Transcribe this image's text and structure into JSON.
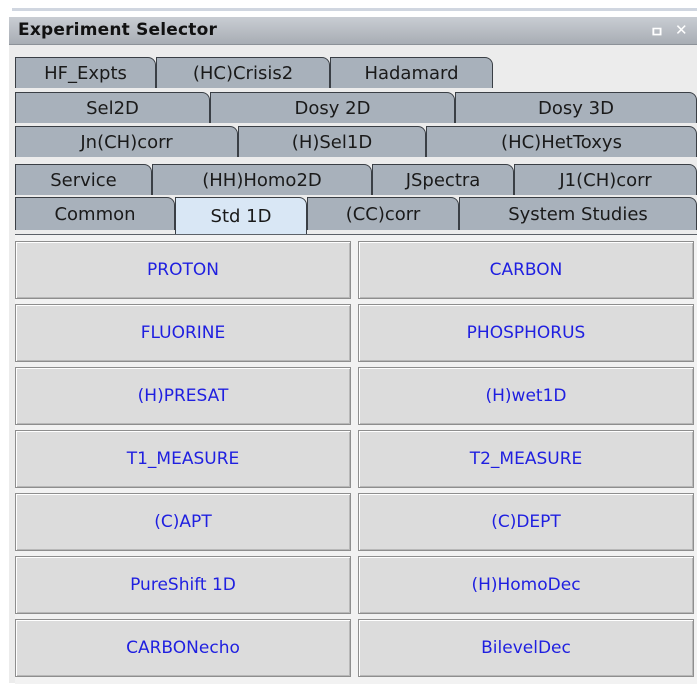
{
  "window": {
    "title": "Experiment Selector",
    "pin_icon": "pin-icon",
    "close_icon": "close-icon"
  },
  "tab_rows": [
    [
      "HF_Expts",
      "(HC)Crisis2",
      "Hadamard"
    ],
    [
      "Sel2D",
      "Dosy 2D",
      "Dosy 3D"
    ],
    [
      "Jn(CH)corr",
      "(H)Sel1D",
      "(HC)HetToxys"
    ],
    [
      "Service",
      "(HH)Homo2D",
      "JSpectra",
      "J1(CH)corr"
    ],
    [
      "Common",
      "Std 1D",
      "(CC)corr",
      "System Studies"
    ]
  ],
  "active_tab": "Std 1D",
  "buttons": [
    [
      "PROTON",
      "CARBON"
    ],
    [
      "FLUORINE",
      "PHOSPHORUS"
    ],
    [
      "(H)PRESAT",
      "(H)wet1D"
    ],
    [
      "T1_MEASURE",
      "T2_MEASURE"
    ],
    [
      "(C)APT",
      "(C)DEPT"
    ],
    [
      "PureShift 1D",
      "(H)HomoDec"
    ],
    [
      "CARBONecho",
      "BilevelDec"
    ]
  ],
  "colors": {
    "tab_bg": "#a8b1bb",
    "active_tab_bg": "#d9e7f5",
    "button_text": "#1f1fe0"
  }
}
